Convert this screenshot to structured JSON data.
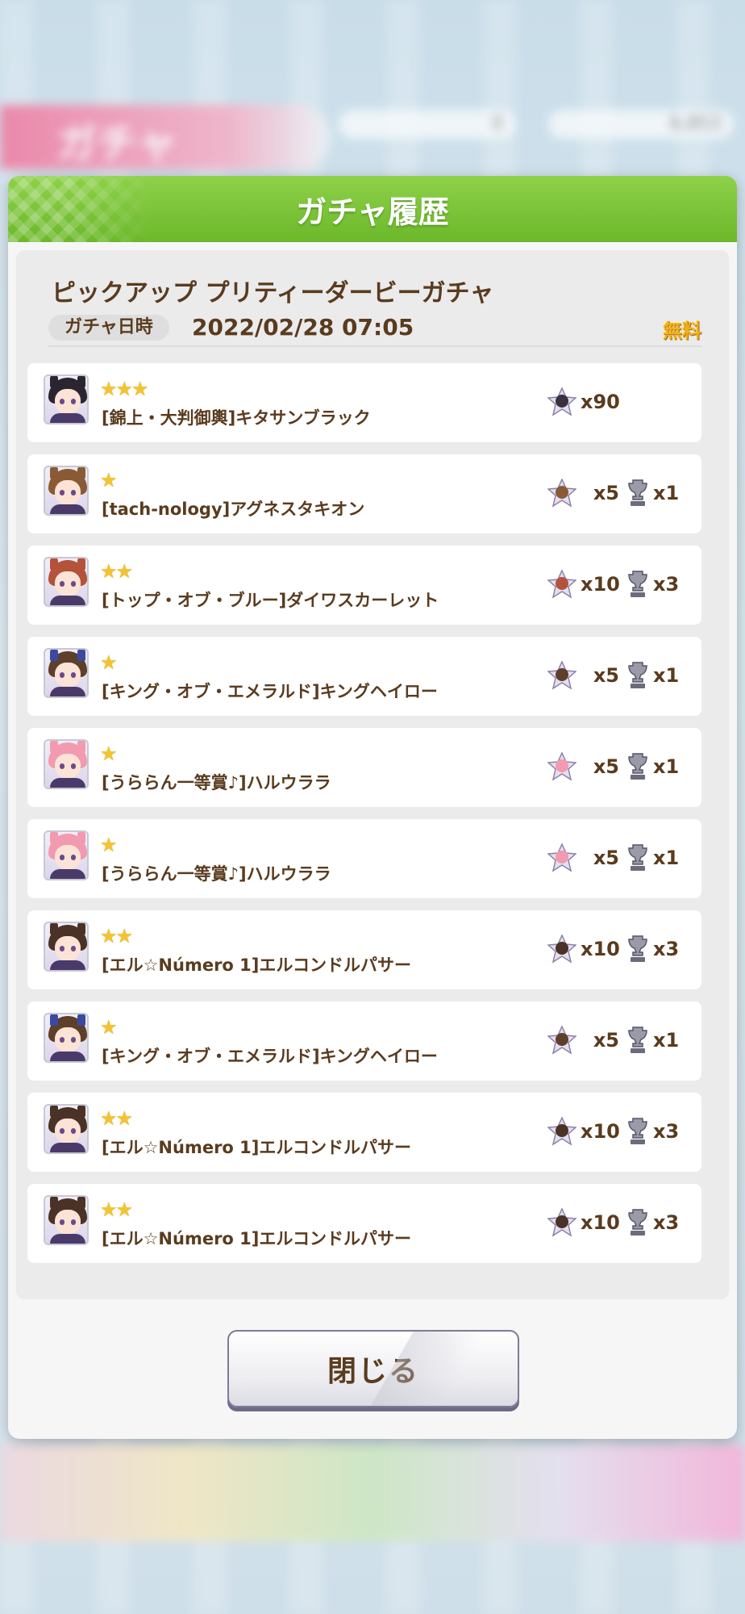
{
  "background": {
    "header_title": "ガチャ",
    "currency_1": "0",
    "currency_2": "6,853"
  },
  "dialog": {
    "title": "ガチャ履歴",
    "banner_title": "ピックアップ プリティーダービーガチャ",
    "date_label": "ガチャ日時",
    "date_value": "2022/02/28 07:05",
    "free_label": "無料",
    "close_label": "閉じる"
  },
  "results": [
    {
      "stars": "★★★",
      "name": "[錦上・大判御輿]キタサンブラック",
      "piece_count": "x90",
      "trophy_count": "",
      "hair": "#2b2530",
      "piece_color": "#3a3040",
      "ear": "#2b2530"
    },
    {
      "stars": "★",
      "name": "[tach-nology]アグネスタキオン",
      "piece_count": "x5",
      "trophy_count": "x1",
      "hair": "#8a5a34",
      "piece_color": "#8a5a34",
      "ear": "#8a5a34"
    },
    {
      "stars": "★★",
      "name": "[トップ・オブ・ブルー]ダイワスカーレット",
      "piece_count": "x10",
      "trophy_count": "x3",
      "hair": "#b4523a",
      "piece_color": "#b4523a",
      "ear": "#b4523a"
    },
    {
      "stars": "★",
      "name": "[キング・オブ・エメラルド]キングヘイロー",
      "piece_count": "x5",
      "trophy_count": "x1",
      "hair": "#5e3f2a",
      "piece_color": "#5e3f2a",
      "ear": "#3a4aa0"
    },
    {
      "stars": "★",
      "name": "[うららん一等賞♪]ハルウララ",
      "piece_count": "x5",
      "trophy_count": "x1",
      "hair": "#f29ab0",
      "piece_color": "#f29ab0",
      "ear": "#f29ab0"
    },
    {
      "stars": "★",
      "name": "[うららん一等賞♪]ハルウララ",
      "piece_count": "x5",
      "trophy_count": "x1",
      "hair": "#f29ab0",
      "piece_color": "#f29ab0",
      "ear": "#f29ab0"
    },
    {
      "stars": "★★",
      "name": "[エル☆Número 1]エルコンドルパサー",
      "piece_count": "x10",
      "trophy_count": "x3",
      "hair": "#4a3226",
      "piece_color": "#4a3226",
      "ear": "#4a3226"
    },
    {
      "stars": "★",
      "name": "[キング・オブ・エメラルド]キングヘイロー",
      "piece_count": "x5",
      "trophy_count": "x1",
      "hair": "#5e3f2a",
      "piece_color": "#5e3f2a",
      "ear": "#3a4aa0"
    },
    {
      "stars": "★★",
      "name": "[エル☆Número 1]エルコンドルパサー",
      "piece_count": "x10",
      "trophy_count": "x3",
      "hair": "#4a3226",
      "piece_color": "#4a3226",
      "ear": "#4a3226"
    },
    {
      "stars": "★★",
      "name": "[エル☆Número 1]エルコンドルパサー",
      "piece_count": "x10",
      "trophy_count": "x3",
      "hair": "#4a3226",
      "piece_color": "#4a3226",
      "ear": "#4a3226"
    }
  ]
}
